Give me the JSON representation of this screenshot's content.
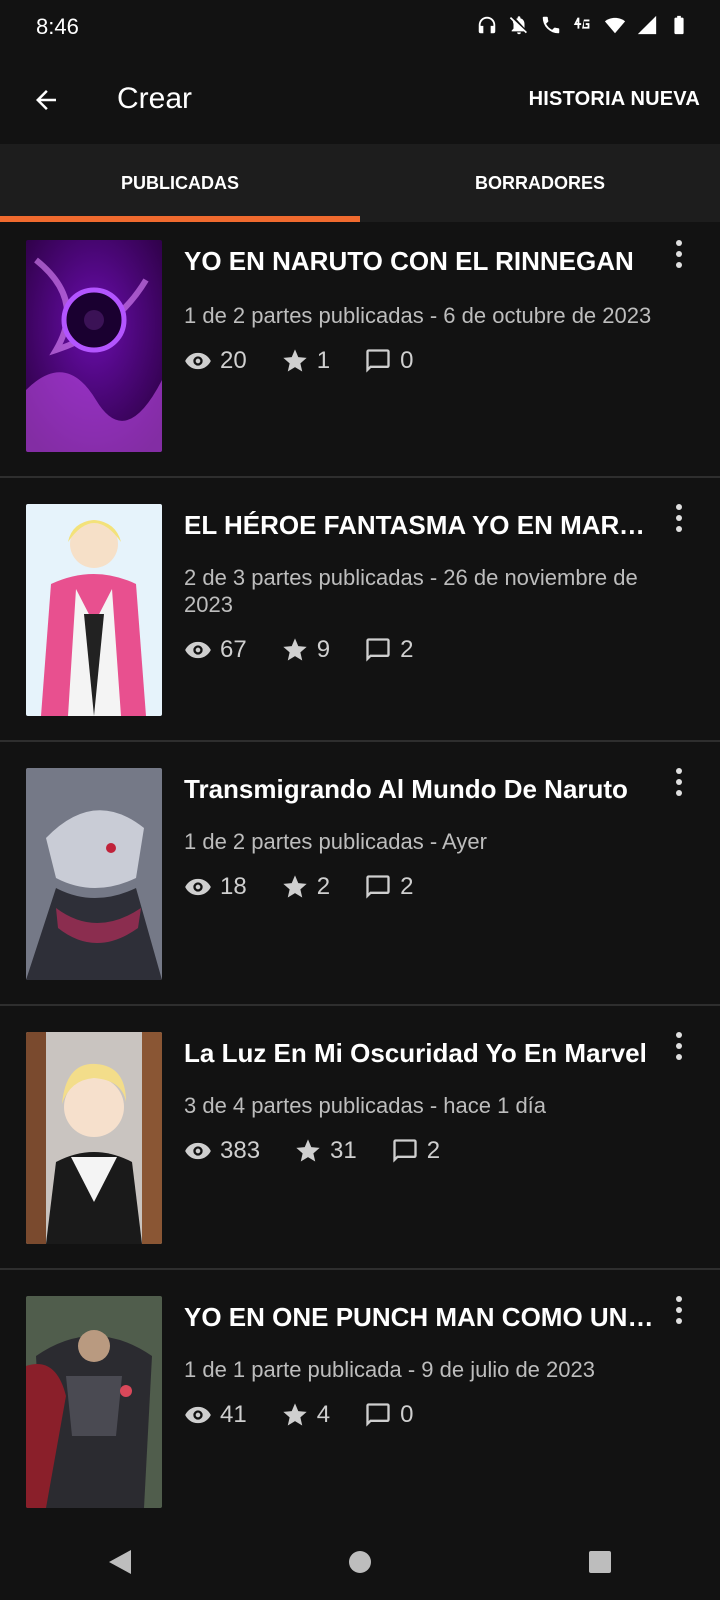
{
  "status_bar": {
    "time": "8:46",
    "icons": [
      "headphones-icon",
      "bell-off-icon",
      "wifi-call-icon",
      "4g-icon",
      "wifi-icon",
      "signal-icon",
      "battery-icon"
    ]
  },
  "appbar": {
    "title": "Crear",
    "action_label": "HISTORIA NUEVA"
  },
  "tabs": [
    {
      "label": "PUBLICADAS",
      "active": true
    },
    {
      "label": "BORRADORES",
      "active": false
    }
  ],
  "accent_color": "#f06a2e",
  "stories": [
    {
      "title": "YO EN NARUTO CON EL RINNEGAN",
      "meta": "1 de 2 partes publicadas - 6 de octubre de 2023",
      "views": "20",
      "votes": "1",
      "comments": "0"
    },
    {
      "title": "EL HÉROE FANTASMA YO EN MARVEL",
      "meta": "2 de 3 partes publicadas - 26 de noviembre de 2023",
      "views": "67",
      "votes": "9",
      "comments": "2"
    },
    {
      "title": "Transmigrando Al Mundo De Naruto",
      "meta": "1 de 2 partes publicadas - Ayer",
      "views": "18",
      "votes": "2",
      "comments": "2"
    },
    {
      "title": "La Luz En Mi Oscuridad Yo En Marvel",
      "meta": "3 de 4 partes publicadas - hace 1 día",
      "views": "383",
      "votes": "31",
      "comments": "2"
    },
    {
      "title": "YO  EN ONE PUNCH MAN COMO UN HÉROE",
      "meta": "1 de 1 parte publicada - 9 de julio de 2023",
      "views": "41",
      "votes": "4",
      "comments": "0"
    }
  ]
}
